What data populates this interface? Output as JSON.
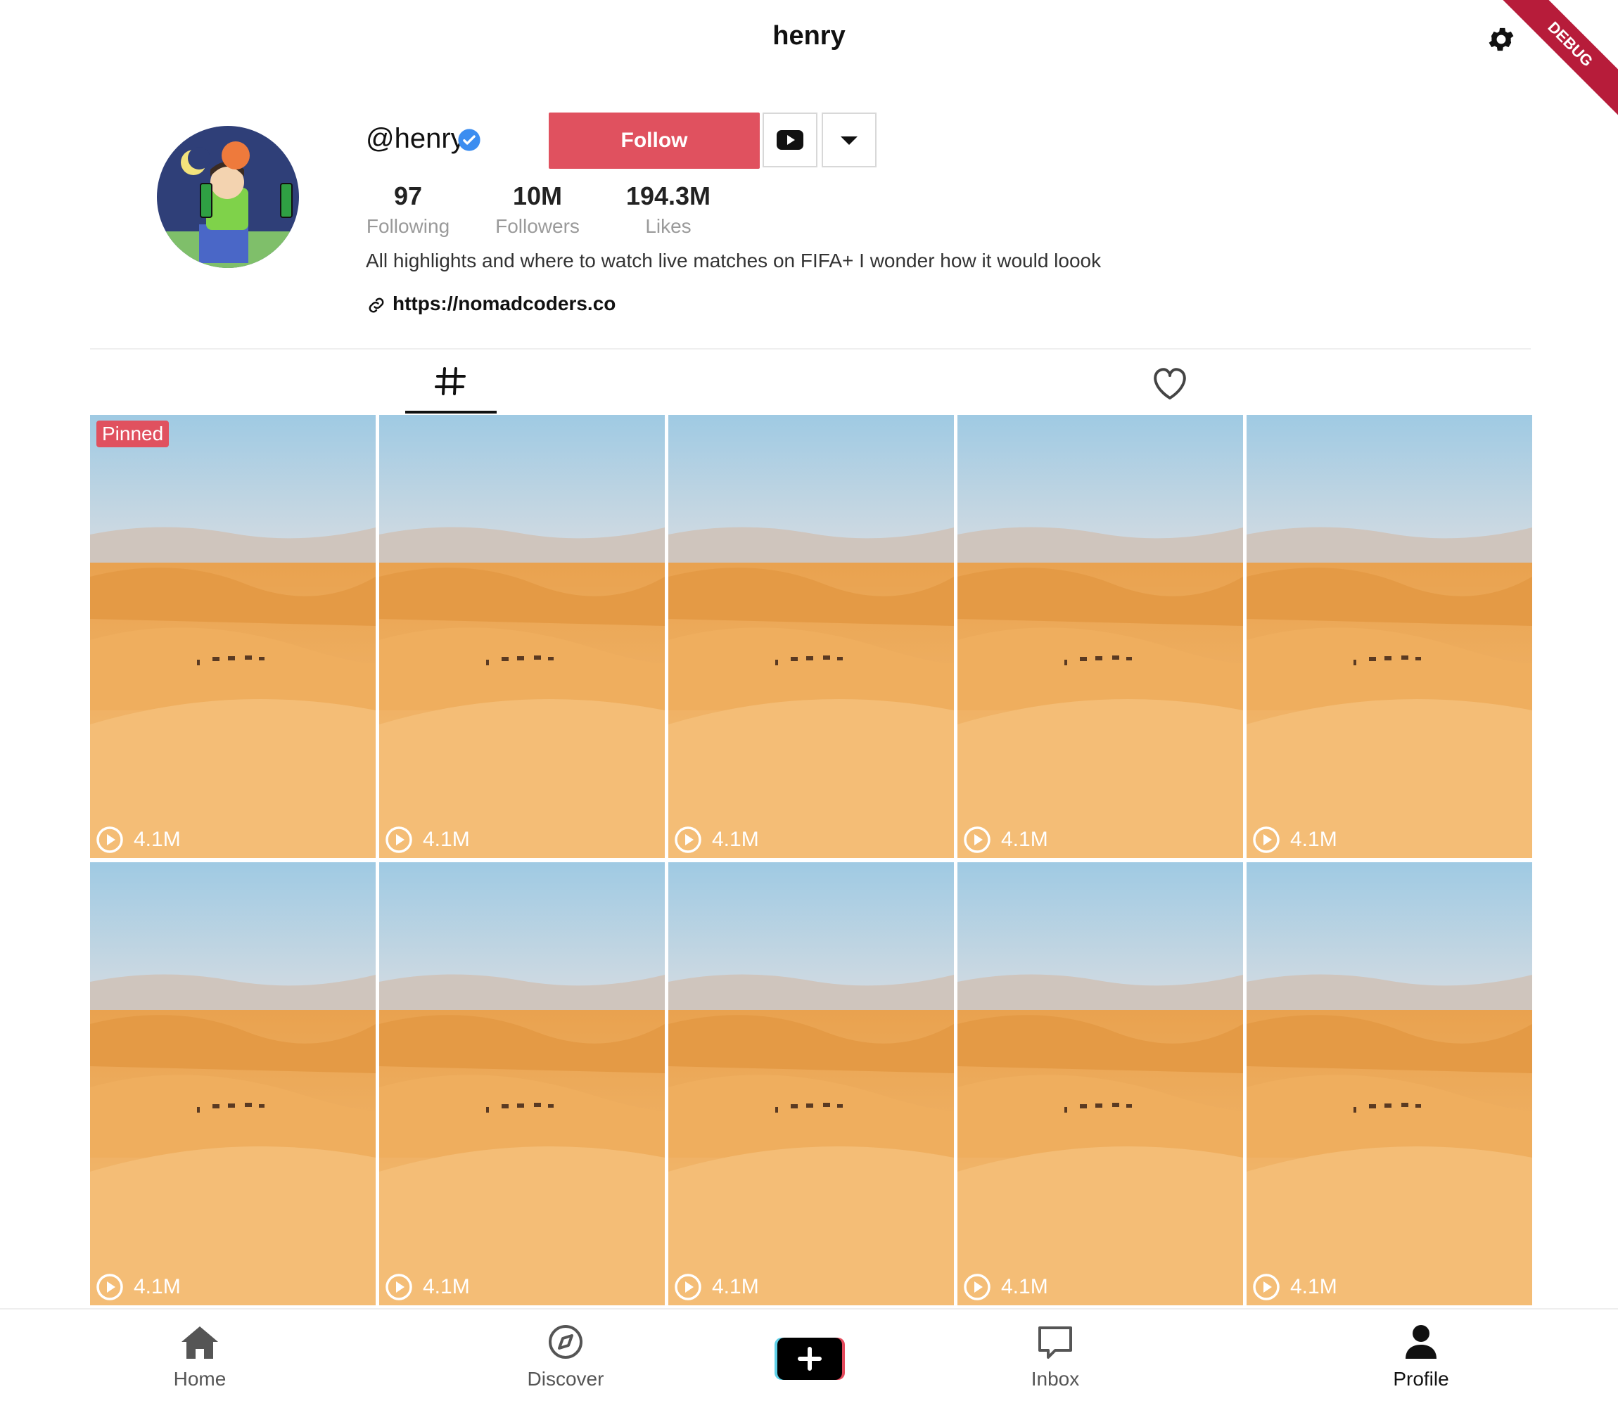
{
  "appbar": {
    "title": "henry",
    "debug_banner": "DEBUG"
  },
  "profile": {
    "handle": "@henry",
    "follow_label": "Follow",
    "stats": [
      {
        "value": "97",
        "label": "Following"
      },
      {
        "value": "10M",
        "label": "Followers"
      },
      {
        "value": "194.3M",
        "label": "Likes"
      }
    ],
    "bio": "All highlights and where to watch live matches on FIFA+ I wonder how it would loook",
    "link": "https://nomadcoders.co"
  },
  "tabs": {
    "active": "grid-icon",
    "icons": [
      "grid-icon",
      "heart-icon"
    ]
  },
  "grid": {
    "pinned_label": "Pinned",
    "tiles": [
      {
        "views": "4.1M",
        "pinned": true
      },
      {
        "views": "4.1M"
      },
      {
        "views": "4.1M"
      },
      {
        "views": "4.1M"
      },
      {
        "views": "4.1M"
      },
      {
        "views": "4.1M"
      },
      {
        "views": "4.1M"
      },
      {
        "views": "4.1M"
      },
      {
        "views": "4.1M"
      },
      {
        "views": "4.1M"
      }
    ]
  },
  "nav": {
    "items": [
      {
        "label": "Home",
        "icon": "home-icon"
      },
      {
        "label": "Discover",
        "icon": "compass-icon"
      },
      {
        "label": "Inbox",
        "icon": "chat-icon"
      },
      {
        "label": "Profile",
        "icon": "person-icon",
        "active": true
      }
    ],
    "add_icon": "plus-icon"
  },
  "colors": {
    "accent": "#e0515f",
    "sand": "#f0b063",
    "sky": "#a8cfe3"
  }
}
